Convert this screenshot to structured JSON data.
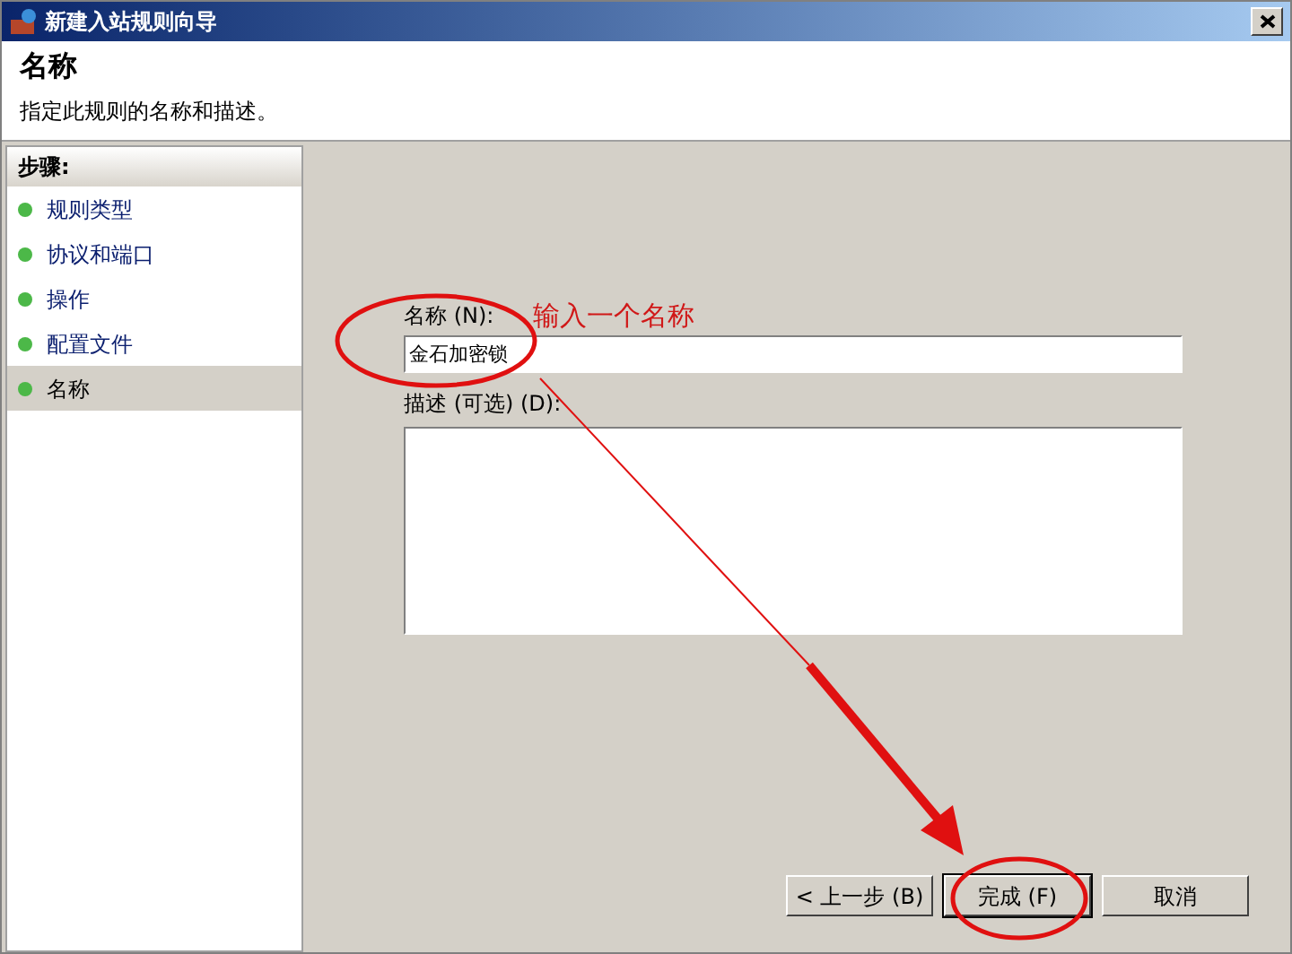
{
  "window": {
    "title": "新建入站规则向导"
  },
  "header": {
    "title": "名称",
    "subtitle": "指定此规则的名称和描述。"
  },
  "steps": {
    "heading": "步骤:",
    "items": [
      {
        "label": "规则类型",
        "selected": false
      },
      {
        "label": "协议和端口",
        "selected": false
      },
      {
        "label": "操作",
        "selected": false
      },
      {
        "label": "配置文件",
        "selected": false
      },
      {
        "label": "名称",
        "selected": true
      }
    ]
  },
  "form": {
    "name_label": "名称 (N):",
    "name_value": "金石加密锁",
    "description_label": "描述 (可选) (D):"
  },
  "annotation": {
    "text": "输入一个名称"
  },
  "buttons": [
    {
      "label": "< 上一步 (B)",
      "default": false
    },
    {
      "label": "完成 (F)",
      "default": true
    },
    {
      "label": "取消",
      "default": false
    }
  ]
}
